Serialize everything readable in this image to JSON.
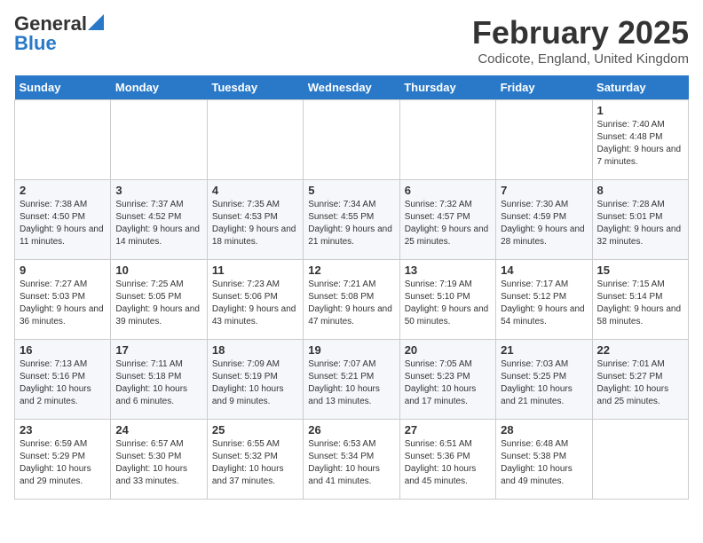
{
  "logo": {
    "general": "General",
    "blue": "Blue"
  },
  "title": "February 2025",
  "subtitle": "Codicote, England, United Kingdom",
  "days_of_week": [
    "Sunday",
    "Monday",
    "Tuesday",
    "Wednesday",
    "Thursday",
    "Friday",
    "Saturday"
  ],
  "weeks": [
    [
      {
        "day": "",
        "info": ""
      },
      {
        "day": "",
        "info": ""
      },
      {
        "day": "",
        "info": ""
      },
      {
        "day": "",
        "info": ""
      },
      {
        "day": "",
        "info": ""
      },
      {
        "day": "",
        "info": ""
      },
      {
        "day": "1",
        "info": "Sunrise: 7:40 AM\nSunset: 4:48 PM\nDaylight: 9 hours and 7 minutes."
      }
    ],
    [
      {
        "day": "2",
        "info": "Sunrise: 7:38 AM\nSunset: 4:50 PM\nDaylight: 9 hours and 11 minutes."
      },
      {
        "day": "3",
        "info": "Sunrise: 7:37 AM\nSunset: 4:52 PM\nDaylight: 9 hours and 14 minutes."
      },
      {
        "day": "4",
        "info": "Sunrise: 7:35 AM\nSunset: 4:53 PM\nDaylight: 9 hours and 18 minutes."
      },
      {
        "day": "5",
        "info": "Sunrise: 7:34 AM\nSunset: 4:55 PM\nDaylight: 9 hours and 21 minutes."
      },
      {
        "day": "6",
        "info": "Sunrise: 7:32 AM\nSunset: 4:57 PM\nDaylight: 9 hours and 25 minutes."
      },
      {
        "day": "7",
        "info": "Sunrise: 7:30 AM\nSunset: 4:59 PM\nDaylight: 9 hours and 28 minutes."
      },
      {
        "day": "8",
        "info": "Sunrise: 7:28 AM\nSunset: 5:01 PM\nDaylight: 9 hours and 32 minutes."
      }
    ],
    [
      {
        "day": "9",
        "info": "Sunrise: 7:27 AM\nSunset: 5:03 PM\nDaylight: 9 hours and 36 minutes."
      },
      {
        "day": "10",
        "info": "Sunrise: 7:25 AM\nSunset: 5:05 PM\nDaylight: 9 hours and 39 minutes."
      },
      {
        "day": "11",
        "info": "Sunrise: 7:23 AM\nSunset: 5:06 PM\nDaylight: 9 hours and 43 minutes."
      },
      {
        "day": "12",
        "info": "Sunrise: 7:21 AM\nSunset: 5:08 PM\nDaylight: 9 hours and 47 minutes."
      },
      {
        "day": "13",
        "info": "Sunrise: 7:19 AM\nSunset: 5:10 PM\nDaylight: 9 hours and 50 minutes."
      },
      {
        "day": "14",
        "info": "Sunrise: 7:17 AM\nSunset: 5:12 PM\nDaylight: 9 hours and 54 minutes."
      },
      {
        "day": "15",
        "info": "Sunrise: 7:15 AM\nSunset: 5:14 PM\nDaylight: 9 hours and 58 minutes."
      }
    ],
    [
      {
        "day": "16",
        "info": "Sunrise: 7:13 AM\nSunset: 5:16 PM\nDaylight: 10 hours and 2 minutes."
      },
      {
        "day": "17",
        "info": "Sunrise: 7:11 AM\nSunset: 5:18 PM\nDaylight: 10 hours and 6 minutes."
      },
      {
        "day": "18",
        "info": "Sunrise: 7:09 AM\nSunset: 5:19 PM\nDaylight: 10 hours and 9 minutes."
      },
      {
        "day": "19",
        "info": "Sunrise: 7:07 AM\nSunset: 5:21 PM\nDaylight: 10 hours and 13 minutes."
      },
      {
        "day": "20",
        "info": "Sunrise: 7:05 AM\nSunset: 5:23 PM\nDaylight: 10 hours and 17 minutes."
      },
      {
        "day": "21",
        "info": "Sunrise: 7:03 AM\nSunset: 5:25 PM\nDaylight: 10 hours and 21 minutes."
      },
      {
        "day": "22",
        "info": "Sunrise: 7:01 AM\nSunset: 5:27 PM\nDaylight: 10 hours and 25 minutes."
      }
    ],
    [
      {
        "day": "23",
        "info": "Sunrise: 6:59 AM\nSunset: 5:29 PM\nDaylight: 10 hours and 29 minutes."
      },
      {
        "day": "24",
        "info": "Sunrise: 6:57 AM\nSunset: 5:30 PM\nDaylight: 10 hours and 33 minutes."
      },
      {
        "day": "25",
        "info": "Sunrise: 6:55 AM\nSunset: 5:32 PM\nDaylight: 10 hours and 37 minutes."
      },
      {
        "day": "26",
        "info": "Sunrise: 6:53 AM\nSunset: 5:34 PM\nDaylight: 10 hours and 41 minutes."
      },
      {
        "day": "27",
        "info": "Sunrise: 6:51 AM\nSunset: 5:36 PM\nDaylight: 10 hours and 45 minutes."
      },
      {
        "day": "28",
        "info": "Sunrise: 6:48 AM\nSunset: 5:38 PM\nDaylight: 10 hours and 49 minutes."
      },
      {
        "day": "",
        "info": ""
      }
    ]
  ]
}
